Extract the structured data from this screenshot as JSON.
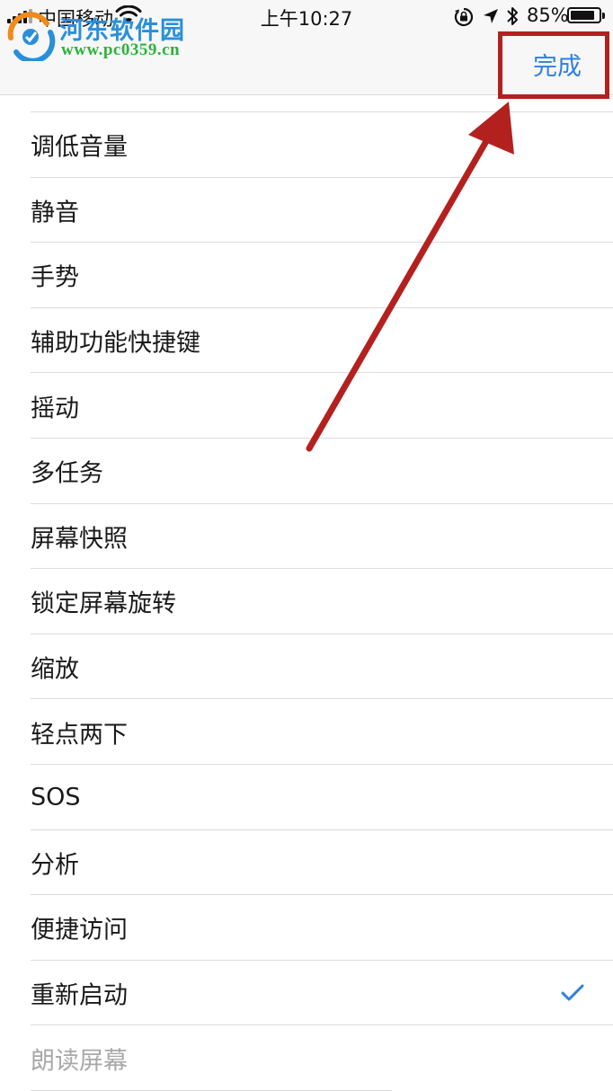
{
  "status_bar": {
    "carrier": "中国移动",
    "time": "上午10:27",
    "battery_percent": "85%",
    "battery_level": 0.85
  },
  "watermark": {
    "title": "河东软件园",
    "url": "www.pc0359.cn"
  },
  "nav": {
    "done_label": "完成"
  },
  "options": [
    {
      "label": "调低音量",
      "checked": false
    },
    {
      "label": "静音",
      "checked": false
    },
    {
      "label": "手势",
      "checked": false
    },
    {
      "label": "辅助功能快捷键",
      "checked": false
    },
    {
      "label": "摇动",
      "checked": false
    },
    {
      "label": "多任务",
      "checked": false
    },
    {
      "label": "屏幕快照",
      "checked": false
    },
    {
      "label": "锁定屏幕旋转",
      "checked": false
    },
    {
      "label": "缩放",
      "checked": false
    },
    {
      "label": "轻点两下",
      "checked": false
    },
    {
      "label": "SOS",
      "checked": false
    },
    {
      "label": "分析",
      "checked": false
    },
    {
      "label": "便捷访问",
      "checked": false
    },
    {
      "label": "重新启动",
      "checked": true
    },
    {
      "label": "朗读屏幕",
      "checked": false
    }
  ],
  "colors": {
    "accent": "#2f7fe0",
    "annotation": "#b3211f"
  }
}
